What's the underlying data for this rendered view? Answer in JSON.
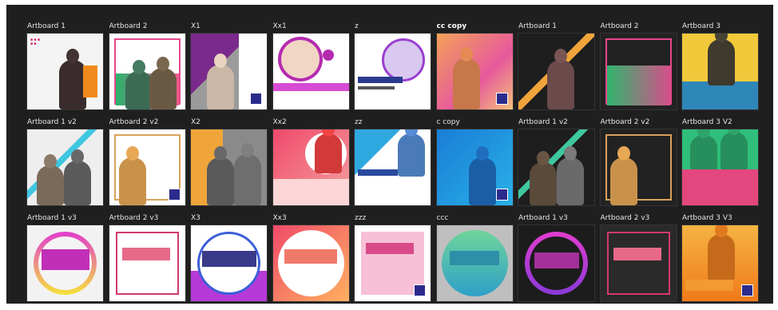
{
  "artboards": [
    {
      "label": "Artboard 1"
    },
    {
      "label": "Artboard 2"
    },
    {
      "label": "X1"
    },
    {
      "label": "Xx1"
    },
    {
      "label": "z"
    },
    {
      "label": "cc copy"
    },
    {
      "label": "Artboard 1"
    },
    {
      "label": "Artboard 2"
    },
    {
      "label": "Artboard 3"
    },
    {
      "label": "Artboard 1 v2"
    },
    {
      "label": "Artboard 2 v2"
    },
    {
      "label": "X2"
    },
    {
      "label": "Xx2"
    },
    {
      "label": "zz"
    },
    {
      "label": "c copy"
    },
    {
      "label": "Artboard 1 v2"
    },
    {
      "label": "Artboard 2 v2"
    },
    {
      "label": "Artboard 3 V2"
    },
    {
      "label": "Artboard 1 v3"
    },
    {
      "label": "Artboard 2 v3"
    },
    {
      "label": "X3"
    },
    {
      "label": "Xx3"
    },
    {
      "label": "zzz"
    },
    {
      "label": "ccc"
    },
    {
      "label": "Artboard 1 v3"
    },
    {
      "label": "Artboard 2 v3"
    },
    {
      "label": "Artboard 3 V3"
    }
  ]
}
